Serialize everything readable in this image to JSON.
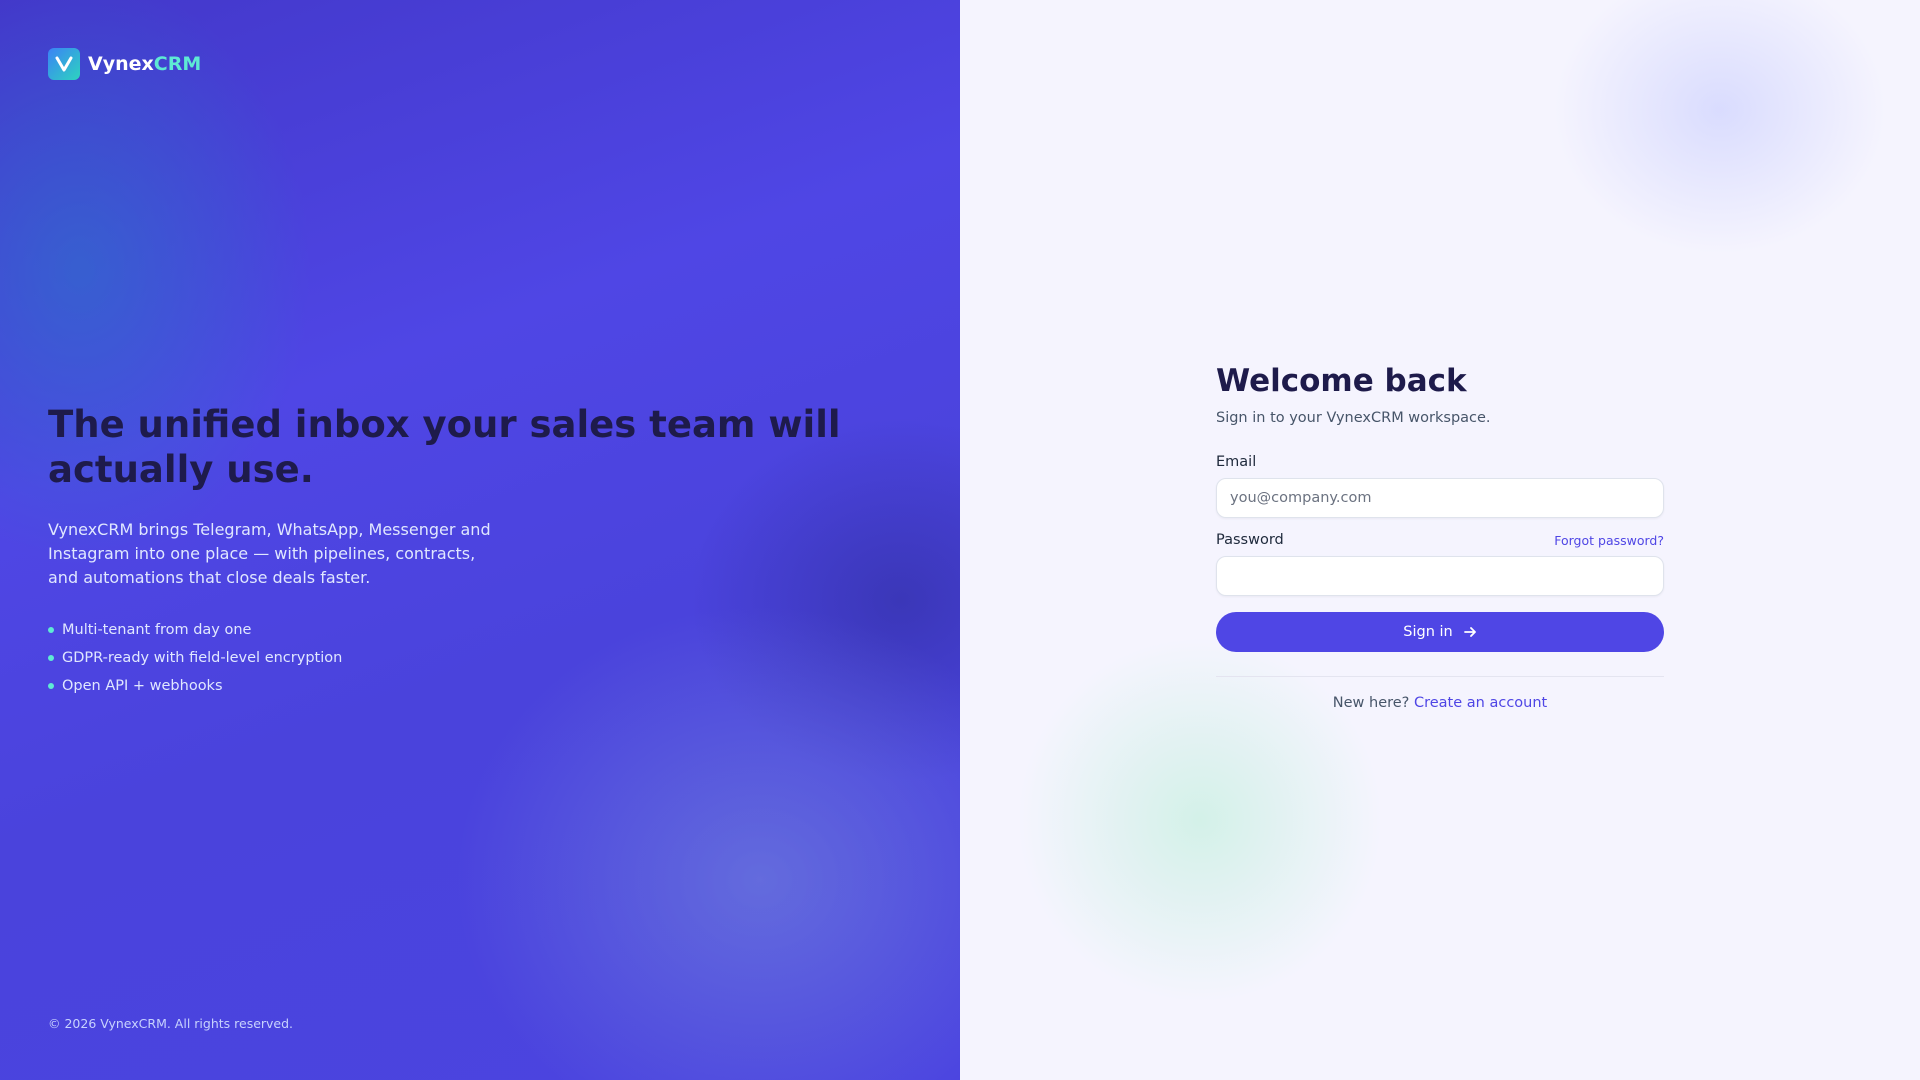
{
  "brand": {
    "name_main": "Vynex",
    "name_accent": "CRM",
    "logo_icon": "v-logo-icon"
  },
  "hero": {
    "title": "The unified inbox your sales team will actually use.",
    "description": "VynexCRM brings Telegram, WhatsApp, Messenger and Instagram into one place — with pipelines, contracts, and automations that close deals faster.",
    "features": [
      "Multi-tenant from day one",
      "GDPR-ready with field-level encryption",
      "Open API + webhooks"
    ]
  },
  "footer": {
    "copyright": "© 2026 VynexCRM. All rights reserved."
  },
  "login": {
    "title": "Welcome back",
    "subtitle": "Sign in to your VynexCRM workspace.",
    "email_label": "Email",
    "email_placeholder": "you@company.com",
    "email_value": "",
    "password_label": "Password",
    "password_value": "",
    "forgot_label": "Forgot password?",
    "signin_label": "Sign in",
    "signin_icon": "arrow-right-icon",
    "signup_prompt": "New here?",
    "signup_link": "Create an account"
  },
  "colors": {
    "primary": "#4f46e5",
    "accent": "#5eead4",
    "heading": "#1e1b4b"
  }
}
